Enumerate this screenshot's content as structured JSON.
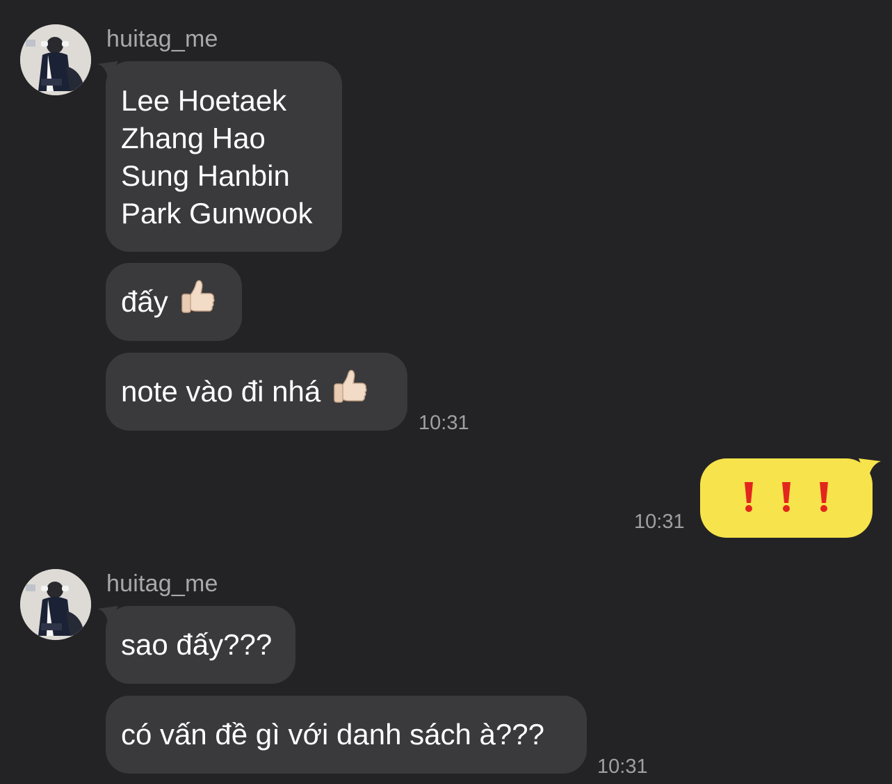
{
  "colors": {
    "background": "#232325",
    "incoming_bubble": "#3a3a3d",
    "outgoing_bubble": "#f7e34b",
    "exclamation": "#e2261d"
  },
  "group1": {
    "sender": "huitag_me",
    "avatar_icon": "profile-photo",
    "message1_lines": [
      "Lee Hoetaek",
      "Zhang Hao",
      "Sung Hanbin",
      "Park Gunwook"
    ],
    "message2_text": "đấy",
    "message2_emoji": "thumbs-up-icon",
    "message3_text": "note vào đi nhá",
    "message3_emoji": "thumbs-up-icon",
    "time": "10:31"
  },
  "outgoing": {
    "content_icon": "triple-exclamation-icon",
    "time": "10:31"
  },
  "group2": {
    "sender": "huitag_me",
    "avatar_icon": "profile-photo",
    "message1_text": "sao đấy???",
    "message2_text": "có vấn đề gì với danh sách à???",
    "time": "10:31"
  }
}
